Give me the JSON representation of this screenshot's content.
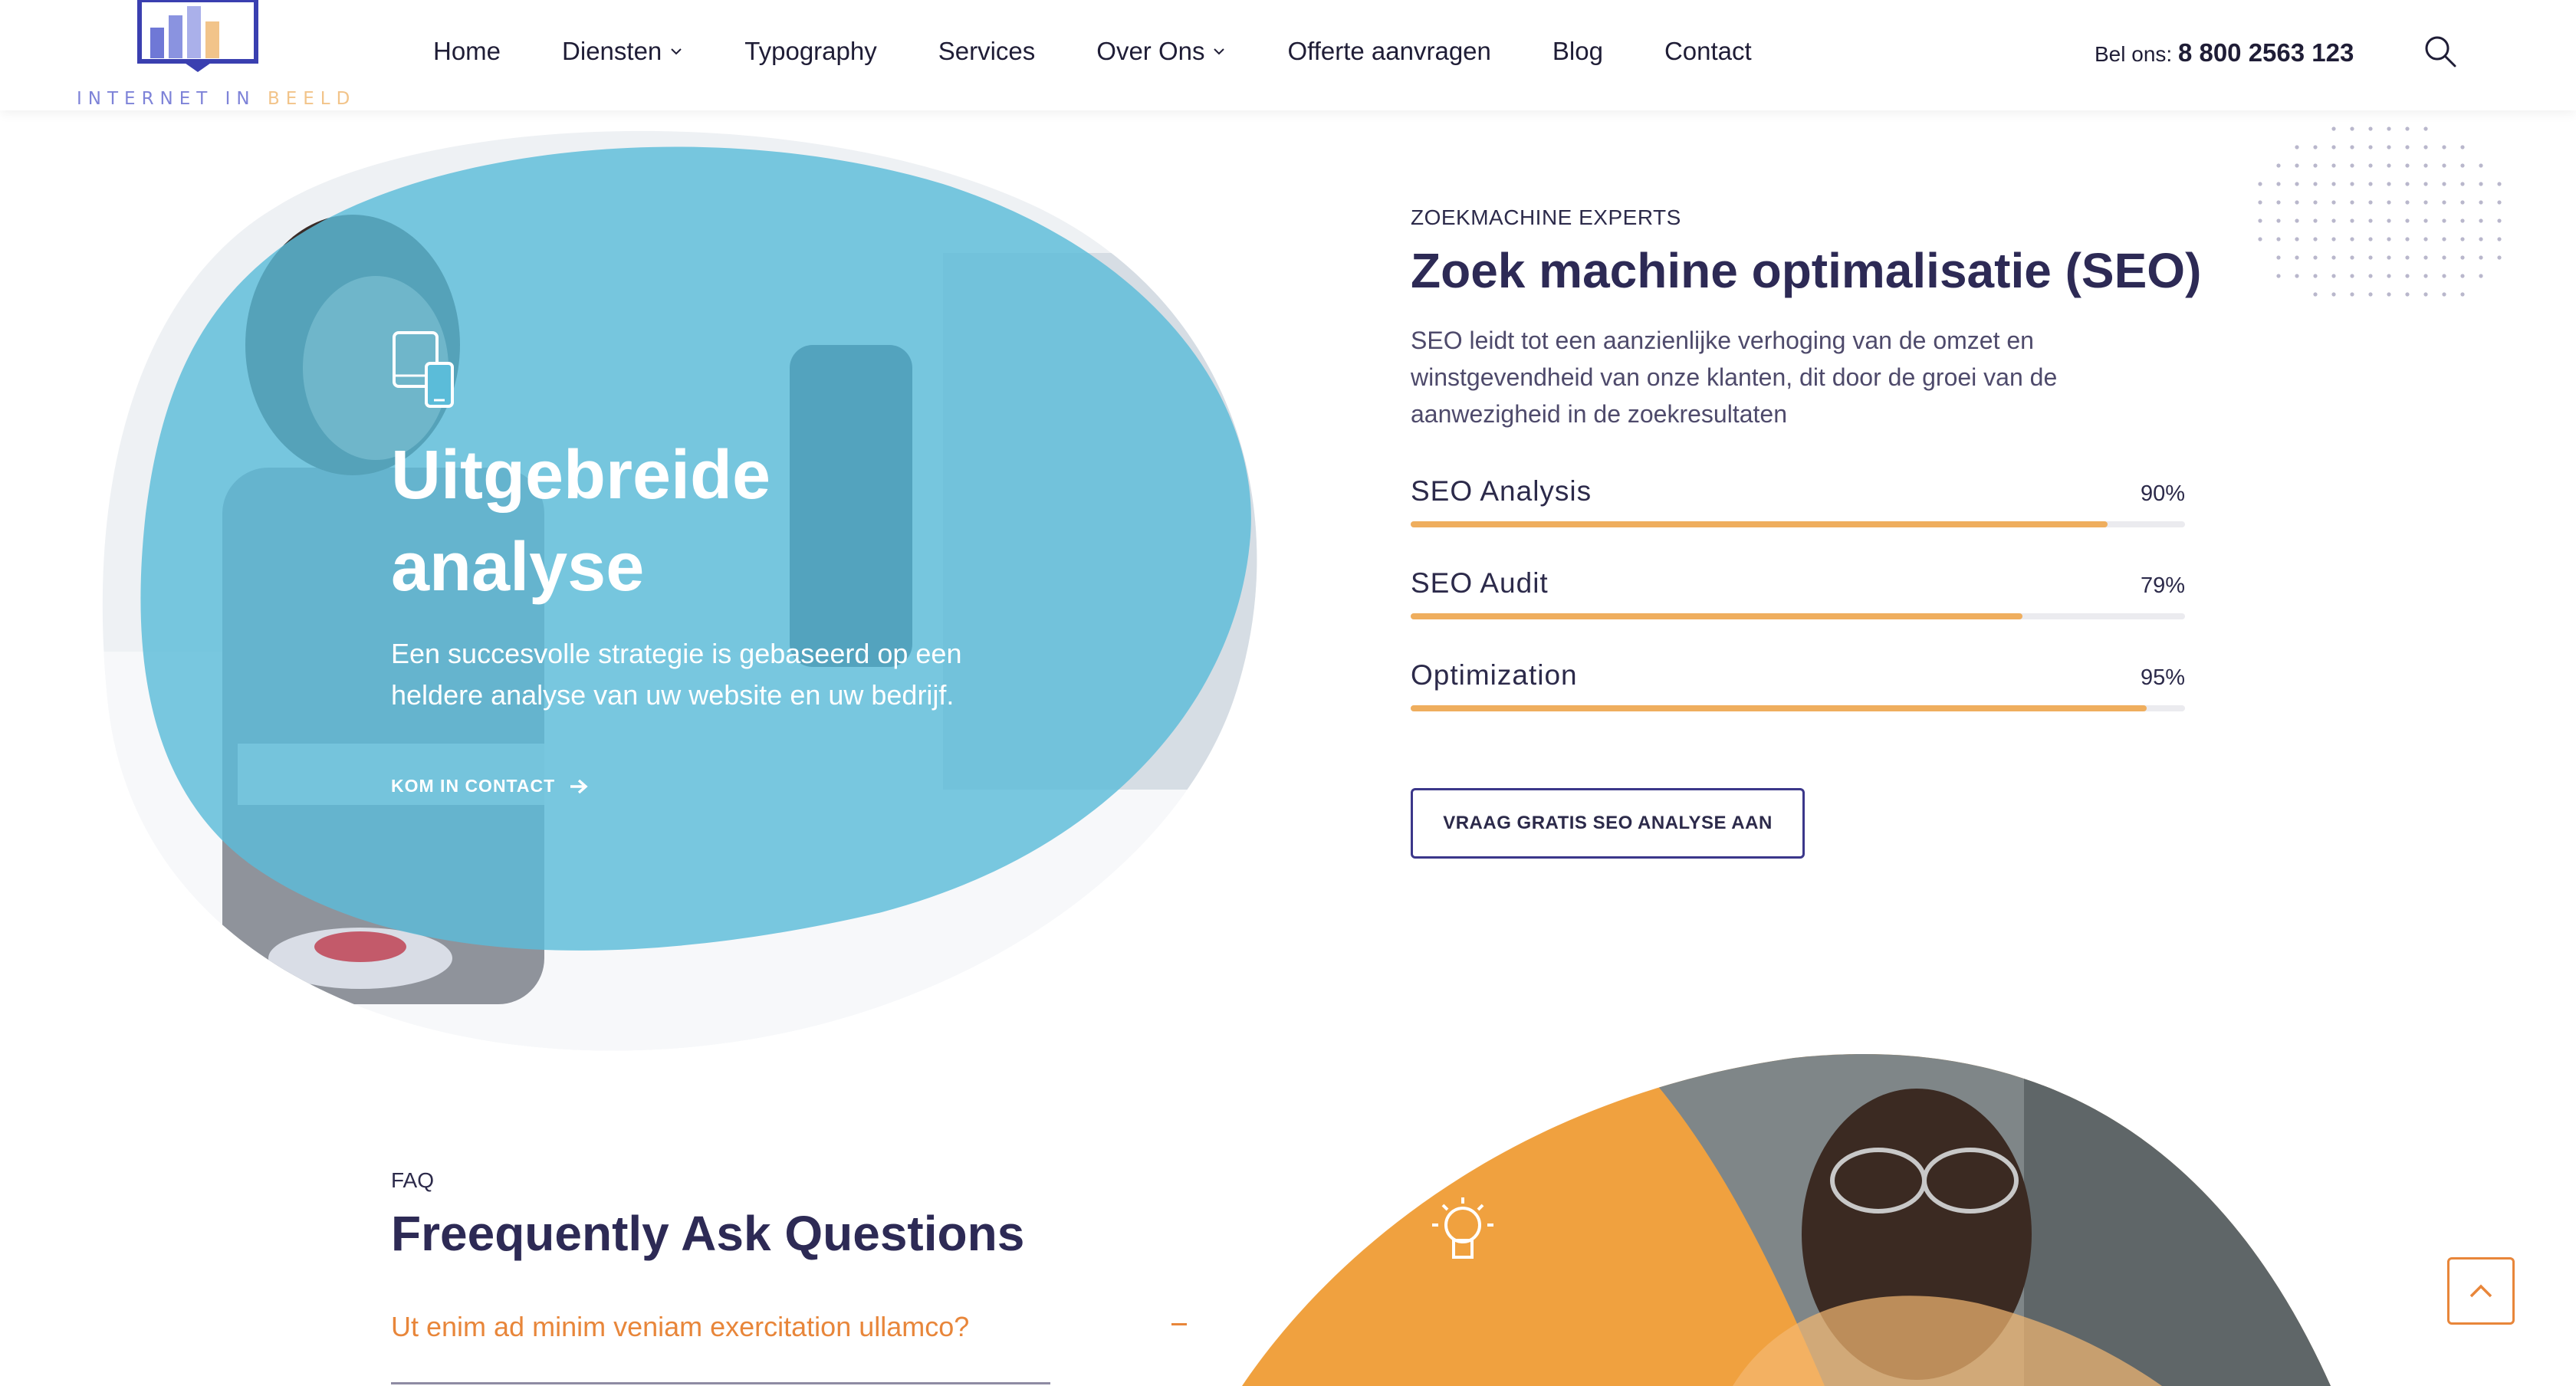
{
  "header": {
    "logo_text_main": "INTERNET IN ",
    "logo_text_light": "BEELD",
    "nav": [
      {
        "label": "Home"
      },
      {
        "label": "Diensten",
        "dropdown": true
      },
      {
        "label": "Typography"
      },
      {
        "label": "Services"
      },
      {
        "label": "Over Ons",
        "dropdown": true
      },
      {
        "label": "Offerte aanvragen"
      },
      {
        "label": "Blog"
      },
      {
        "label": "Contact"
      }
    ],
    "call_label": "Bel ons: ",
    "phone": "8 800 2563 123",
    "search_icon": "search-icon"
  },
  "hero": {
    "icon": "devices-icon",
    "title": "Uitgebreide analyse",
    "description": "Een succesvolle strategie is gebaseerd op een heldere analyse van uw website en uw bedrijf.",
    "link_label": "KOM IN CONTACT",
    "link_icon": "arrow-right-icon",
    "overlay_color": "#5bbcd9"
  },
  "seo": {
    "kicker": "ZOEKMACHINE EXPERTS",
    "title": "Zoek machine optimalisatie (SEO)",
    "description": "SEO leidt tot een aanzienlijke verhoging van de omzet en winstgevendheid van onze klanten, dit door de groei van de aanwezigheid in de zoekresultaten",
    "skills": [
      {
        "label": "SEO Analysis",
        "percent_label": "90%",
        "value": 90
      },
      {
        "label": "SEO Audit",
        "percent_label": "79%",
        "value": 79
      },
      {
        "label": "Optimization",
        "percent_label": "95%",
        "value": 95
      }
    ],
    "button_label": "VRAAG GRATIS SEO ANALYSE AAN",
    "accent": "#efae5e"
  },
  "faq": {
    "kicker": "FAQ",
    "title": "Freequently Ask Questions",
    "question": "Ut enim ad minim veniam exercitation ullamco?",
    "accent": "#e8863a"
  },
  "bottom": {
    "icon": "lightbulb-icon",
    "overlay_color": "#f0a13f"
  },
  "back_to_top": {
    "icon": "chevron-up-icon"
  }
}
